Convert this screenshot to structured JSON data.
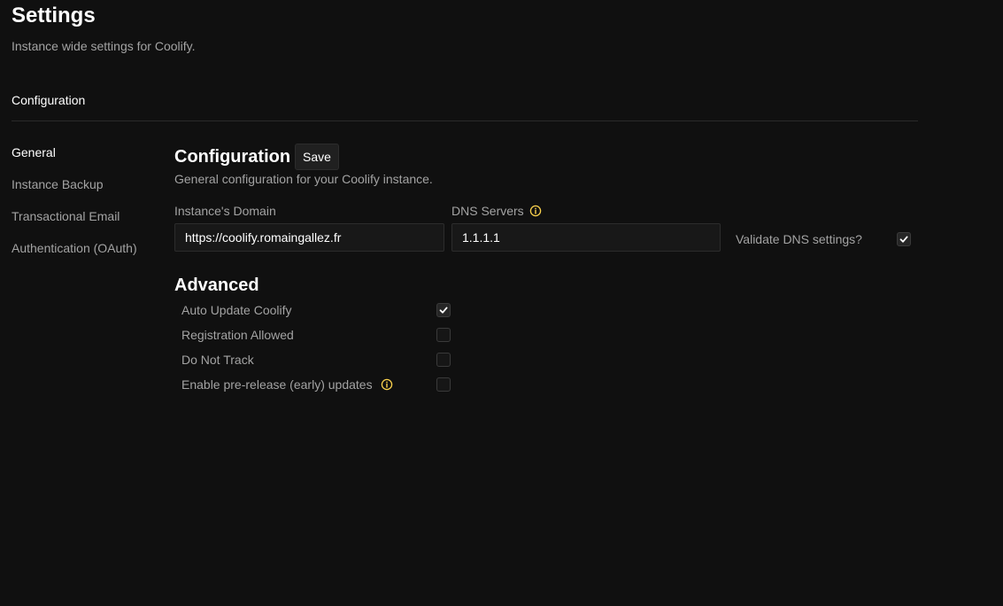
{
  "header": {
    "title": "Settings",
    "subtitle": "Instance wide settings for Coolify."
  },
  "tabs": [
    {
      "label": "Configuration",
      "active": true
    }
  ],
  "sidebar": {
    "items": [
      {
        "label": "General",
        "active": true
      },
      {
        "label": "Instance Backup",
        "active": false
      },
      {
        "label": "Transactional Email",
        "active": false
      },
      {
        "label": "Authentication (OAuth)",
        "active": false
      }
    ]
  },
  "configuration": {
    "title": "Configuration",
    "save_label": "Save",
    "description": "General configuration for your Coolify instance.",
    "domain": {
      "label": "Instance's Domain",
      "value": "https://coolify.romaingallez.fr"
    },
    "dns": {
      "label": "DNS Servers",
      "value": "1.1.1.1",
      "info_icon": "info-circle-icon"
    },
    "validate_dns": {
      "label": "Validate DNS settings?",
      "checked": true
    }
  },
  "advanced": {
    "title": "Advanced",
    "options": [
      {
        "label": "Auto Update Coolify",
        "checked": true,
        "info": false
      },
      {
        "label": "Registration Allowed",
        "checked": false,
        "info": false
      },
      {
        "label": "Do Not Track",
        "checked": false,
        "info": false
      },
      {
        "label": "Enable pre-release (early) updates",
        "checked": false,
        "info": true
      }
    ]
  },
  "colors": {
    "background": "#101010",
    "info_accent": "#fcd34d",
    "muted_text": "#a3a3a3"
  }
}
